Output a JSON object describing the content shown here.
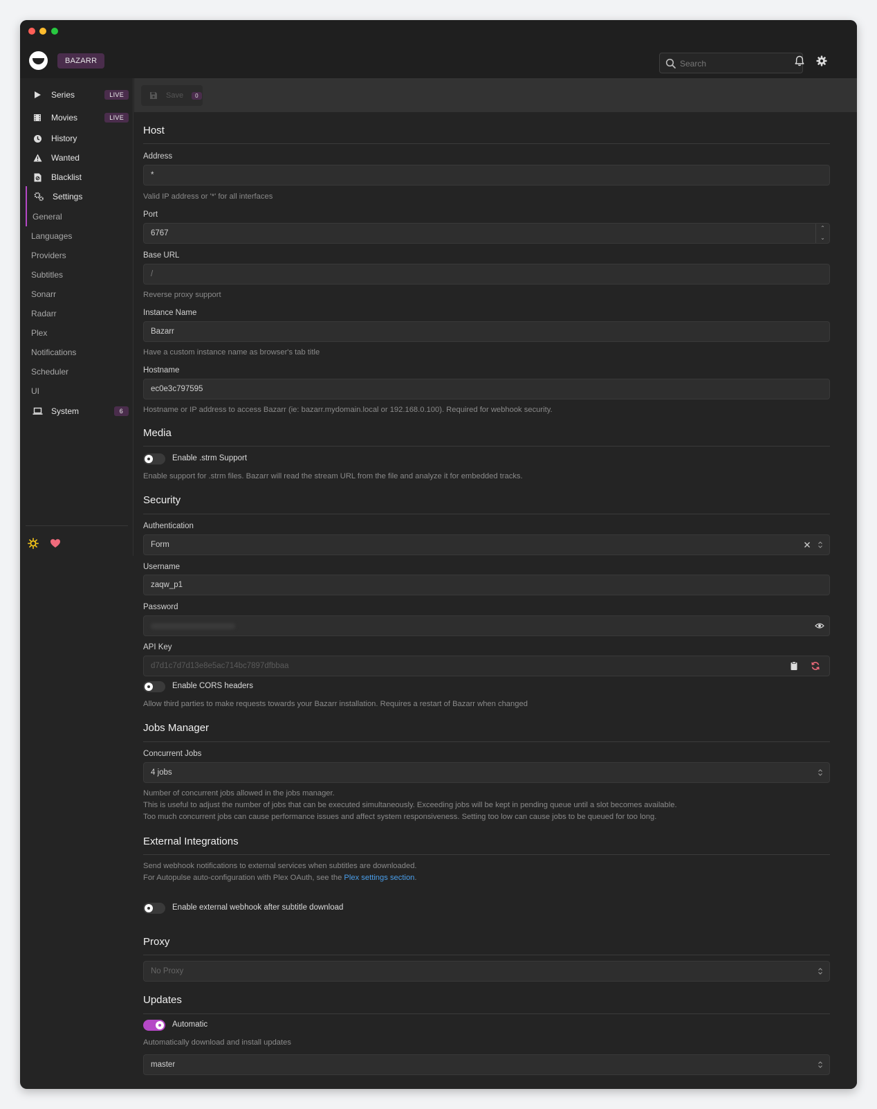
{
  "app": {
    "brand": "BAZARR"
  },
  "search": {
    "placeholder": "Search"
  },
  "sidebar": {
    "items": [
      {
        "label": "Series",
        "badge": "LIVE",
        "icon": "play-icon"
      },
      {
        "label": "Movies",
        "badge": "LIVE",
        "icon": "film-icon"
      },
      {
        "label": "History",
        "icon": "clock-icon"
      },
      {
        "label": "Wanted",
        "icon": "warning-icon"
      },
      {
        "label": "Blacklist",
        "icon": "file-ban-icon"
      },
      {
        "label": "Settings",
        "icon": "cogs-icon"
      }
    ],
    "settings_sub": [
      "General",
      "Languages",
      "Providers",
      "Subtitles",
      "Sonarr",
      "Radarr",
      "Plex",
      "Notifications",
      "Scheduler",
      "UI"
    ],
    "system": {
      "label": "System",
      "badge": "6",
      "icon": "laptop-icon"
    }
  },
  "toolbar": {
    "save_label": "Save",
    "save_count": "0"
  },
  "host": {
    "title": "Host",
    "address_label": "Address",
    "address_value": "*",
    "address_hint": "Valid IP address or '*' for all interfaces",
    "port_label": "Port",
    "port_value": "6767",
    "base_url_label": "Base URL",
    "base_url_placeholder": "/",
    "base_url_hint": "Reverse proxy support",
    "instance_label": "Instance Name",
    "instance_value": "Bazarr",
    "instance_hint": "Have a custom instance name as browser's tab title",
    "hostname_label": "Hostname",
    "hostname_value": "ec0e3c797595",
    "hostname_hint": "Hostname or IP address to access Bazarr (ie: bazarr.mydomain.local or 192.168.0.100). Required for webhook security."
  },
  "media": {
    "title": "Media",
    "strm_label": "Enable .strm Support",
    "strm_hint": "Enable support for .strm files. Bazarr will read the stream URL from the file and analyze it for embedded tracks."
  },
  "security": {
    "title": "Security",
    "auth_label": "Authentication",
    "auth_value": "Form",
    "username_label": "Username",
    "username_value": "zaqw_p1",
    "password_label": "Password",
    "apikey_label": "API Key",
    "apikey_value": "d7d1c7d7d13e8e5ac714bc7897dfbbaa",
    "cors_label": "Enable CORS headers",
    "cors_hint": "Allow third parties to make requests towards your Bazarr installation. Requires a restart of Bazarr when changed"
  },
  "jobs": {
    "title": "Jobs Manager",
    "concurrent_label": "Concurrent Jobs",
    "concurrent_value": "4 jobs",
    "hint1": "Number of concurrent jobs allowed in the jobs manager.",
    "hint2": "This is useful to adjust the number of jobs that can be executed simultaneously. Exceeding jobs will be kept in pending queue until a slot becomes available.",
    "hint3": "Too much concurrent jobs can cause performance issues and affect system responsiveness. Setting too low can cause jobs to be queued for too long."
  },
  "external": {
    "title": "External Integrations",
    "hint1": "Send webhook notifications to external services when subtitles are downloaded.",
    "hint2_prefix": "For Autopulse auto-configuration with Plex OAuth, see the ",
    "hint2_link": "Plex settings section",
    "hint2_suffix": ".",
    "webhook_label": "Enable external webhook after subtitle download"
  },
  "proxy": {
    "title": "Proxy",
    "placeholder": "No Proxy"
  },
  "updates": {
    "title": "Updates",
    "auto_label": "Automatic",
    "auto_hint": "Automatically download and install updates",
    "branch_value": "master"
  },
  "colors": {
    "accent": "#b548c6",
    "badge": "#4a2d4c",
    "link": "#4a9eea",
    "bg": "#242424"
  }
}
